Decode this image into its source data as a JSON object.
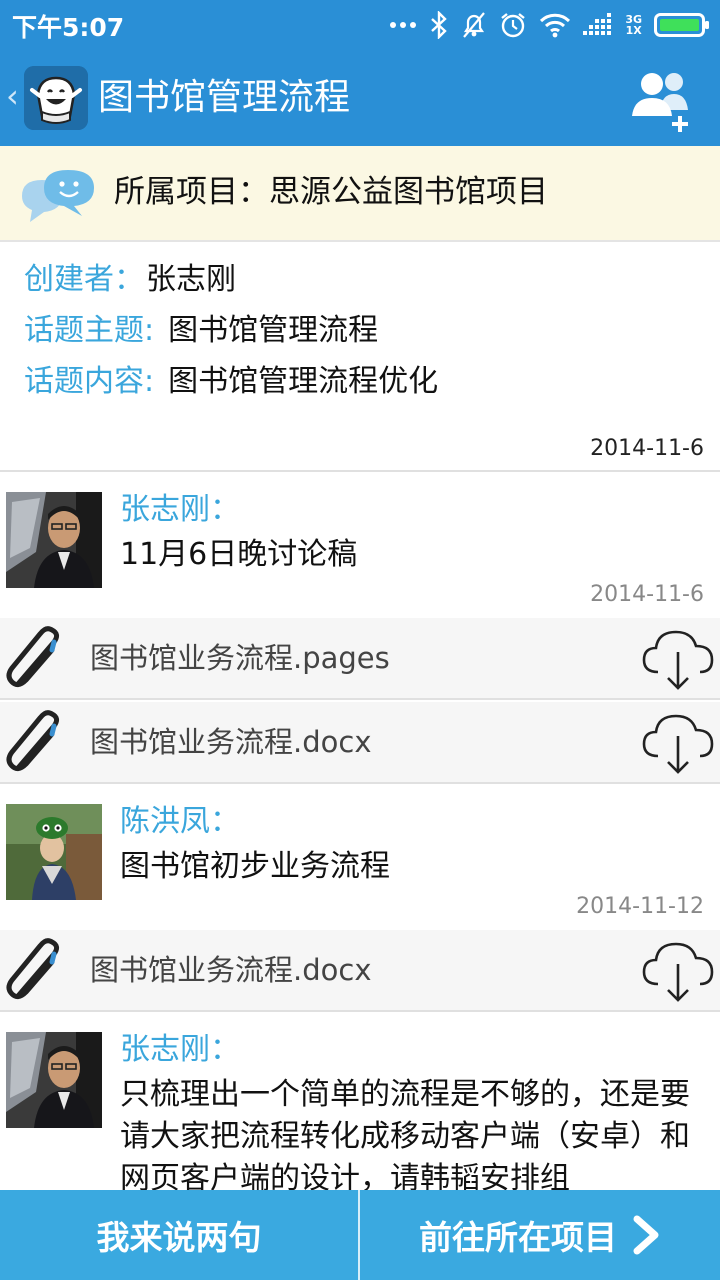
{
  "status_bar": {
    "time": "下午5:07",
    "network_top": "3G",
    "network_bottom": "1X"
  },
  "header": {
    "title": "图书馆管理流程",
    "back_icon": "chevron-left-icon",
    "action_icon": "add-member-icon"
  },
  "project": {
    "label": "所属项目：思源公益图书馆项目"
  },
  "topic": {
    "creator_key": "创建者：",
    "creator_value": "张志刚",
    "subject_key": "话题主题:",
    "subject_value": "图书馆管理流程",
    "content_key": "话题内容:",
    "content_value": "图书馆管理流程优化",
    "date": "2014-11-6"
  },
  "comments": [
    {
      "author": "张志刚：",
      "text": "11月6日晚讨论稿",
      "date": "2014-11-6",
      "attachments": [
        "图书馆业务流程.pages",
        "图书馆业务流程.docx"
      ]
    },
    {
      "author": "陈洪凤：",
      "text": "图书馆初步业务流程",
      "date": "2014-11-12",
      "attachments": [
        "图书馆业务流程.docx"
      ]
    },
    {
      "author": "张志刚：",
      "text": "只梳理出一个简单的流程是不够的，还是要请大家把流程转化成移动客户端（安卓）和网页客户端的设计，请韩韬安排组"
    }
  ],
  "bottom_bar": {
    "reply_label": "我来说两句",
    "goto_project_label": "前往所在项目"
  },
  "colors": {
    "header_blue": "#2a8fd6",
    "accent_blue": "#3aa6dc",
    "bottom_blue": "#3aa9e0",
    "banner_yellow": "#fbf8e3"
  }
}
